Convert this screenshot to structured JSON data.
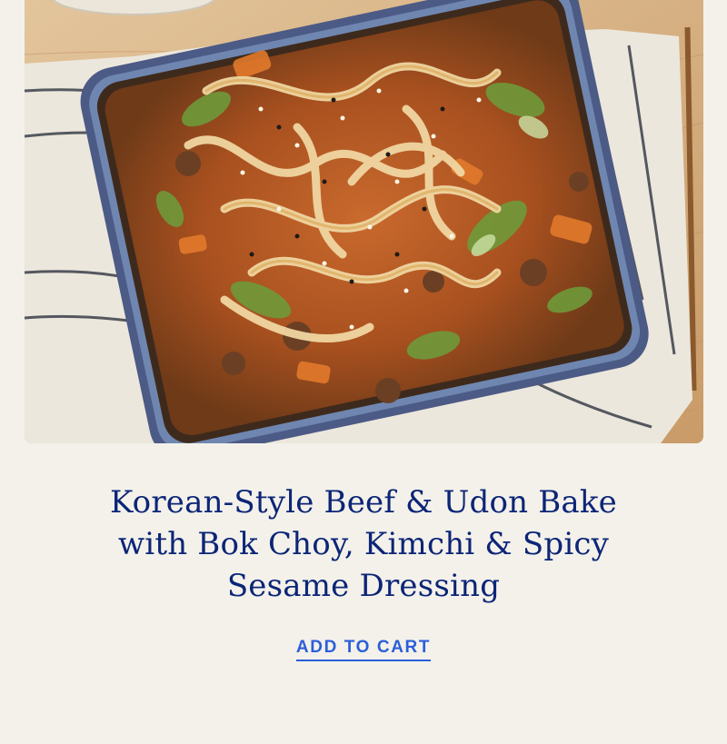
{
  "product": {
    "image_alt": "Korean-Style Beef & Udon Bake dish",
    "title": "Korean-Style Beef & Udon Bake with Bok Choy, Kimchi & Spicy Sesame Dressing",
    "cta_label": "ADD TO CART"
  },
  "colors": {
    "background": "#f3f1ea",
    "title": "#0c2577",
    "link": "#2b5fd9"
  }
}
